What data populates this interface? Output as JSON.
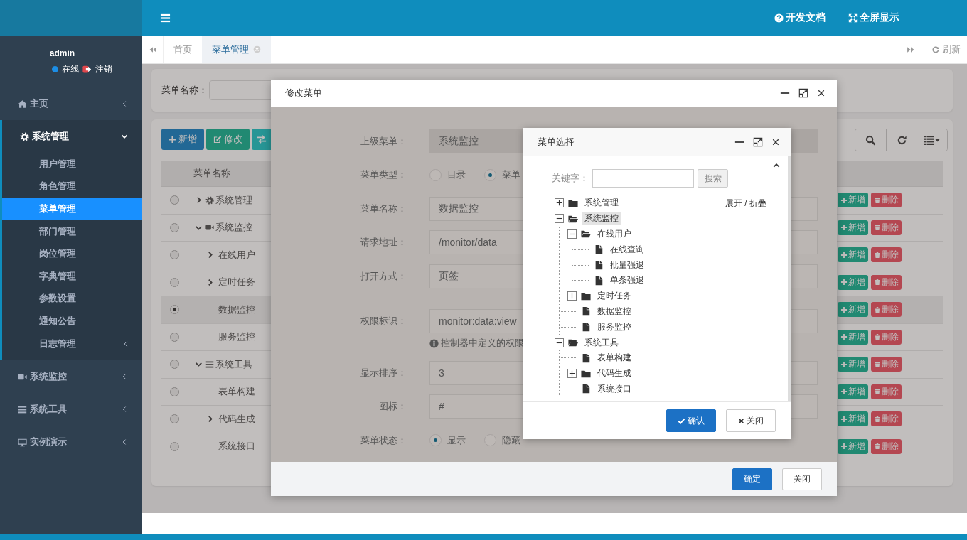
{
  "sidebar": {
    "user": {
      "name": "admin",
      "status": "在线",
      "logout": "注销"
    },
    "menu": [
      {
        "label": "主页",
        "selected": false,
        "expanded": false
      },
      {
        "label": "系统管理",
        "selected": true,
        "expanded": true,
        "children": [
          {
            "label": "用户管理",
            "selected": false
          },
          {
            "label": "角色管理",
            "selected": false
          },
          {
            "label": "菜单管理",
            "selected": true
          },
          {
            "label": "部门管理",
            "selected": false
          },
          {
            "label": "岗位管理",
            "selected": false
          },
          {
            "label": "字典管理",
            "selected": false
          },
          {
            "label": "参数设置",
            "selected": false
          },
          {
            "label": "通知公告",
            "selected": false
          },
          {
            "label": "日志管理",
            "selected": false,
            "expanded": false
          }
        ]
      },
      {
        "label": "系统监控",
        "selected": false,
        "expanded": false
      },
      {
        "label": "系统工具",
        "selected": false,
        "expanded": false
      },
      {
        "label": "实例演示",
        "selected": false,
        "expanded": false
      }
    ]
  },
  "topbar": {
    "links": [
      "开发文档",
      "全屏显示"
    ]
  },
  "tabs": {
    "items": [
      {
        "label": "首页",
        "selected": false
      },
      {
        "label": "菜单管理",
        "selected": true
      }
    ],
    "refresh": "刷新"
  },
  "search": {
    "label": "菜单名称："
  },
  "toolbar": {
    "buttons": [
      "新增",
      "修改"
    ]
  },
  "table": {
    "columns": [
      "菜单名称"
    ],
    "rows": [
      {
        "name": "系统管理",
        "selected": false,
        "expanded": false,
        "actions": [
          "新增",
          "删除"
        ]
      },
      {
        "name": "系统监控",
        "selected": false,
        "expanded": true,
        "actions": [
          "新增",
          "删除"
        ],
        "children": [
          {
            "name": "在线用户",
            "selected": false,
            "expanded": false,
            "actions": [
              "新增",
              "删除"
            ]
          },
          {
            "name": "定时任务",
            "selected": false,
            "expanded": false,
            "actions": [
              "新增",
              "删除"
            ]
          },
          {
            "name": "数据监控",
            "selected": true,
            "actions": [
              "新增",
              "删除"
            ]
          },
          {
            "name": "服务监控",
            "selected": false,
            "actions": [
              "新增",
              "删除"
            ]
          }
        ]
      },
      {
        "name": "系统工具",
        "selected": false,
        "expanded": true,
        "actions": [
          "新增",
          "删除"
        ],
        "children": [
          {
            "name": "表单构建",
            "selected": false,
            "actions": [
              "新增",
              "删除"
            ]
          },
          {
            "name": "代码生成",
            "selected": false,
            "expanded": false,
            "actions": [
              "新增",
              "删除"
            ]
          },
          {
            "name": "系统接口",
            "selected": false,
            "actions": [
              "新增",
              "删除"
            ]
          }
        ]
      }
    ]
  },
  "modal": {
    "title": "修改菜单",
    "fields": [
      {
        "kind": "readonly",
        "label": "上级菜单：",
        "value": "系统监控"
      },
      {
        "kind": "radio",
        "label": "菜单类型：",
        "options": [
          {
            "label": "目录",
            "selected": false
          },
          {
            "label": "菜单",
            "selected": true
          }
        ]
      },
      {
        "kind": "input",
        "label": "菜单名称：",
        "value": "数据监控"
      },
      {
        "kind": "input",
        "label": "请求地址：",
        "value": "/monitor/data"
      },
      {
        "kind": "select",
        "label": "打开方式：",
        "value": "页签"
      },
      {
        "kind": "input",
        "label": "权限标识：",
        "value": "monitor:data:view",
        "help": "控制器中定义的权限"
      },
      {
        "kind": "input",
        "label": "显示排序：",
        "value": "3"
      },
      {
        "kind": "input",
        "label": "图标：",
        "value": "#"
      },
      {
        "kind": "radio",
        "label": "菜单状态：",
        "options": [
          {
            "label": "显示",
            "selected": true
          },
          {
            "label": "隐藏",
            "selected": false
          }
        ]
      }
    ],
    "buttons": [
      "确定",
      "关闭"
    ]
  },
  "picker": {
    "title": "菜单选择",
    "keyword_label": "关键字：",
    "search_button": "搜索",
    "toggle_all": "展开 / 折叠",
    "tree": [
      {
        "label": "系统管理",
        "kind": "folder",
        "expanded": false,
        "selected": false
      },
      {
        "label": "系统监控",
        "kind": "folder",
        "expanded": true,
        "selected": true,
        "children": [
          {
            "label": "在线用户",
            "kind": "folder",
            "expanded": true,
            "selected": false,
            "children": [
              {
                "label": "在线查询",
                "kind": "page",
                "selected": false
              },
              {
                "label": "批量强退",
                "kind": "page",
                "selected": false
              },
              {
                "label": "单条强退",
                "kind": "page",
                "selected": false
              }
            ]
          },
          {
            "label": "定时任务",
            "kind": "folder",
            "expanded": false,
            "selected": false
          },
          {
            "label": "数据监控",
            "kind": "page",
            "selected": false
          },
          {
            "label": "服务监控",
            "kind": "page",
            "selected": false
          }
        ]
      },
      {
        "label": "系统工具",
        "kind": "folder",
        "expanded": true,
        "selected": false,
        "children": [
          {
            "label": "表单构建",
            "kind": "page",
            "selected": false
          },
          {
            "label": "代码生成",
            "kind": "folder",
            "expanded": false,
            "selected": false
          },
          {
            "label": "系统接口",
            "kind": "page",
            "selected": false
          }
        ]
      }
    ],
    "buttons": [
      "确认",
      "关闭"
    ]
  }
}
